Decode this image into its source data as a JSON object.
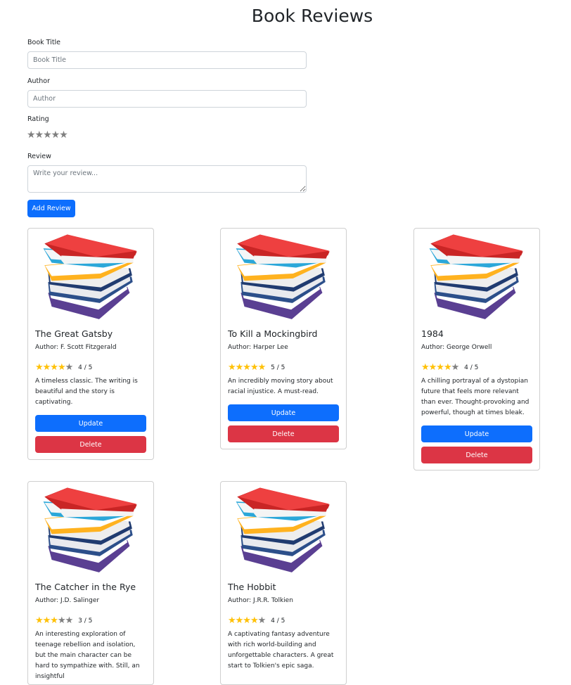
{
  "page": {
    "title": "Book Reviews"
  },
  "form": {
    "title_label": "Book Title",
    "title_placeholder": "Book Title",
    "author_label": "Author",
    "author_placeholder": "Author",
    "rating_label": "Rating",
    "rating_stars": "★★★★★",
    "review_label": "Review",
    "review_placeholder": "Write your review...",
    "add_button": "Add Review"
  },
  "colors": {
    "primary": "#0d6efd",
    "danger": "#dc3545",
    "star_filled": "#ffc107",
    "star_empty": "#808080"
  },
  "reviews": [
    {
      "title": "The Great Gatsby",
      "author": "Author: F. Scott Fitzgerald",
      "stars_on": "★★★★",
      "stars_off": "★",
      "rating": 4,
      "rating_text": "4 / 5",
      "review": "A timeless classic. The writing is beautiful and the story is captivating.",
      "update": "Update",
      "delete": "Delete"
    },
    {
      "title": "To Kill a Mockingbird",
      "author": "Author: Harper Lee",
      "stars_on": "★★★★★",
      "stars_off": "",
      "rating": 5,
      "rating_text": "5 / 5",
      "review": "An incredibly moving story about racial injustice. A must-read.",
      "update": "Update",
      "delete": "Delete"
    },
    {
      "title": "1984",
      "author": "Author: George Orwell",
      "stars_on": "★★★★",
      "stars_off": "★",
      "rating": 4,
      "rating_text": "4 / 5",
      "review": "A chilling portrayal of a dystopian future that feels more relevant than ever. Thought-provoking and powerful, though at times bleak.",
      "update": "Update",
      "delete": "Delete"
    },
    {
      "title": "The Catcher in the Rye",
      "author": "Author: J.D. Salinger",
      "stars_on": "★★★",
      "stars_off": "★★",
      "rating": 3,
      "rating_text": "3 / 5",
      "review": "An interesting exploration of teenage rebellion and isolation, but the main character can be hard to sympathize with. Still, an insightful"
    },
    {
      "title": "The Hobbit",
      "author": "Author: J.R.R. Tolkien",
      "stars_on": "★★★★",
      "stars_off": "★",
      "rating": 4,
      "rating_text": "4 / 5",
      "review": "A captivating fantasy adventure with rich world-building and unforgettable characters. A great start to Tolkien's epic saga."
    }
  ]
}
